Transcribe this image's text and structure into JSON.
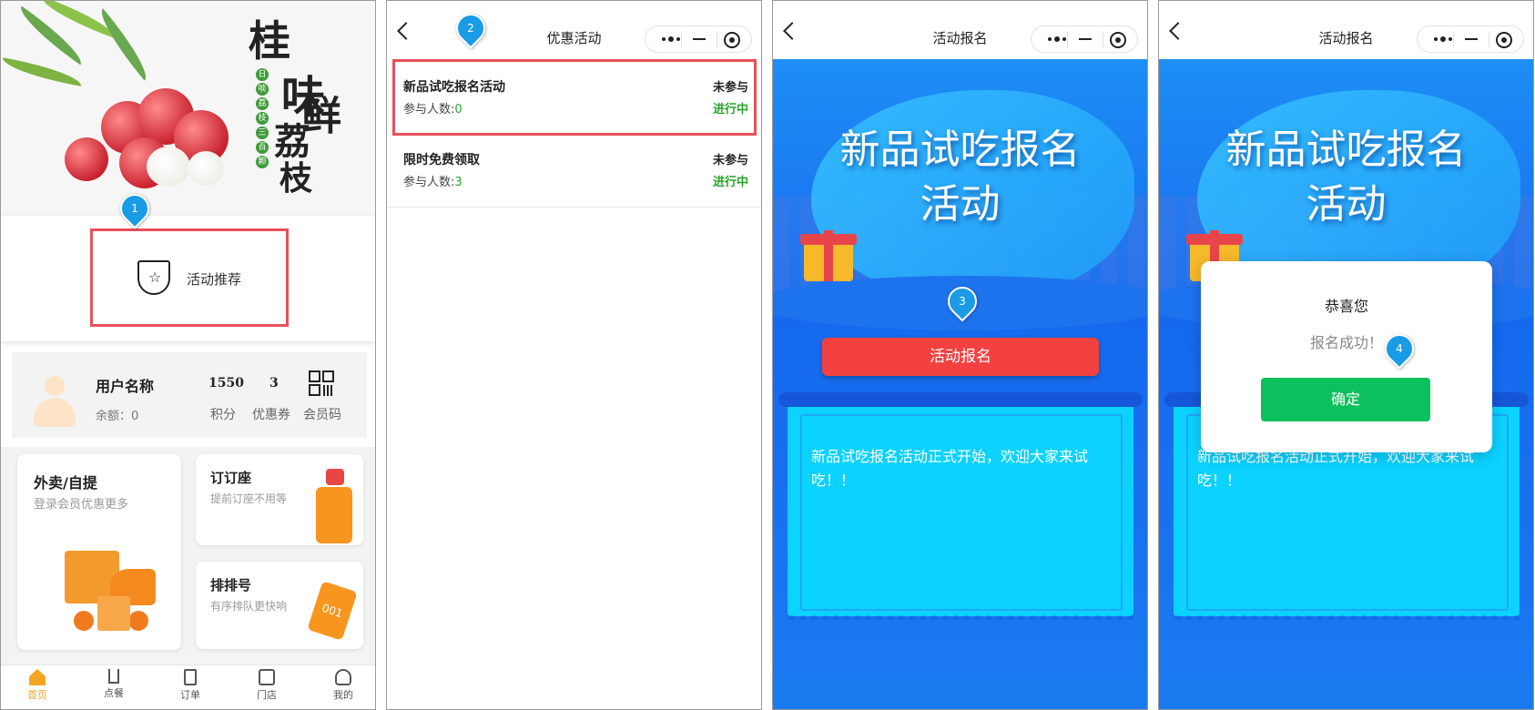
{
  "panel1": {
    "banner": {
      "brand_main": [
        "桂",
        "味",
        "鲜",
        "荔",
        "枝"
      ],
      "brand_tags": [
        "日",
        "啖",
        "荔",
        "枝",
        "三",
        "百",
        "颗"
      ]
    },
    "promo": {
      "label": "活动推荐"
    },
    "user": {
      "name": "用户名称",
      "balance": "余额：0",
      "points_value": "1550",
      "points_label": "积分",
      "coupons_value": "3",
      "coupons_label": "优惠券",
      "member_code_label": "会员码"
    },
    "tiles": {
      "takeout_title": "外卖/自提",
      "takeout_sub": "登录会员优惠更多",
      "reserve_title": "订订座",
      "reserve_sub": "提前订座不用等",
      "queue_title": "排排号",
      "queue_sub": "有序排队更快响",
      "ticket_number": "001"
    },
    "tabbar": [
      {
        "label": "首页",
        "icon": "home-icon"
      },
      {
        "label": "点餐",
        "icon": "fork-knife-icon"
      },
      {
        "label": "订单",
        "icon": "document-icon"
      },
      {
        "label": "门店",
        "icon": "store-icon"
      },
      {
        "label": "我的",
        "icon": "user-icon"
      }
    ]
  },
  "panel2": {
    "nav_title": "优惠活动",
    "items": [
      {
        "title": "新品试吃报名活动",
        "count_label": "参与人数:",
        "count": "0",
        "state": "未参与",
        "status": "进行中"
      },
      {
        "title": "限时免费领取",
        "count_label": "参与人数:",
        "count": "3",
        "state": "未参与",
        "status": "进行中"
      }
    ]
  },
  "panel3": {
    "nav_title": "活动报名",
    "event_title_line1": "新品试吃报名",
    "event_title_line2": "活动",
    "signup_button": "活动报名",
    "description": "新品试吃报名活动正式开始，欢迎大家来试吃！！"
  },
  "panel4": {
    "nav_title": "活动报名",
    "event_title_line1": "新品试吃报名",
    "event_title_line2": "活动",
    "description": "新品试吃报名活动正式开始，欢迎大家来试吃！！",
    "dialog": {
      "title": "恭喜您",
      "message": "报名成功！",
      "confirm": "确定"
    }
  },
  "markers": [
    "1",
    "2",
    "3",
    "4"
  ],
  "colors": {
    "highlight": "#e8505b",
    "marker": "#1a9be6",
    "status_green": "#2aa52a",
    "signup_red": "#f2413f",
    "confirm_green": "#0cc05d",
    "tab_active": "#f5a623"
  }
}
